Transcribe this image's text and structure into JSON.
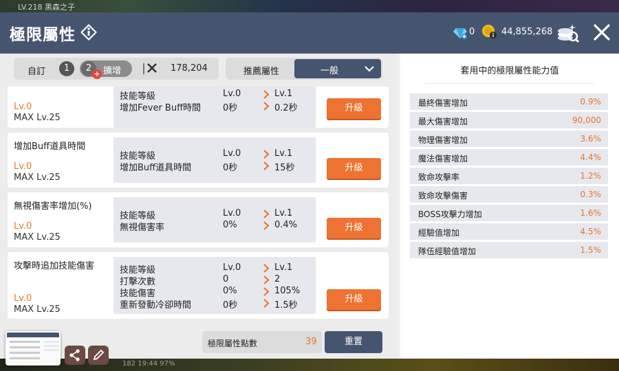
{
  "game_bg": {
    "level_text": "LV.218 黑森之子",
    "status_text": "182 19:44    97%"
  },
  "header": {
    "title": "極限屬性",
    "gem_count": "0",
    "gold_count": "44,855,268"
  },
  "filter": {
    "custom_tab": "自訂",
    "slot1": "1",
    "slot2": "2",
    "expand_label": "擴增",
    "points": "178,204",
    "recommend_label": "推薦屬性",
    "recommend_value": "一般"
  },
  "cards": [
    {
      "name": "",
      "level": "Lv.0",
      "max": "MAX Lv.25",
      "upgrade": "升級",
      "stats": [
        {
          "name": "技能等級",
          "cur": "Lv.0",
          "next": "Lv.1"
        },
        {
          "name": "增加Fever Buff時間",
          "cur": "0秒",
          "next": "0.2秒"
        }
      ]
    },
    {
      "name": "增加Buff道具時間",
      "level": "Lv.0",
      "max": "MAX Lv.25",
      "upgrade": "升級",
      "stats": [
        {
          "name": "技能等級",
          "cur": "Lv.0",
          "next": "Lv.1"
        },
        {
          "name": "增加Buff道具時間",
          "cur": "0秒",
          "next": "15秒"
        }
      ]
    },
    {
      "name": "無視傷害率增加(%)",
      "level": "Lv.0",
      "max": "MAX Lv.25",
      "upgrade": "升級",
      "stats": [
        {
          "name": "技能等級",
          "cur": "Lv.0",
          "next": "Lv.1"
        },
        {
          "name": "無視傷害率",
          "cur": "0%",
          "next": "0.4%"
        }
      ]
    },
    {
      "name": "攻擊時追加技能傷害",
      "level": "Lv.0",
      "max": "MAX Lv.25",
      "upgrade": "升級",
      "stats": [
        {
          "name": "技能等級",
          "cur": "Lv.0",
          "next": "Lv.1"
        },
        {
          "name": "打擊次數",
          "cur": "0",
          "next": "2"
        },
        {
          "name": "技能傷害",
          "cur": "0%",
          "next": "105%"
        },
        {
          "name": "重新發動冷卻時間",
          "cur": "0秒",
          "next": "1.5秒"
        }
      ]
    }
  ],
  "bottom": {
    "points_label": "極限屬性點數",
    "points_value": "39",
    "reset_label": "重置"
  },
  "summary": {
    "title": "套用中的極限屬性能力值",
    "rows": [
      {
        "name": "最終傷害增加",
        "value": "0.9%"
      },
      {
        "name": "最大傷害增加",
        "value": "90,000"
      },
      {
        "name": "物理傷害增加",
        "value": "3.6%"
      },
      {
        "name": "魔法傷害增加",
        "value": "4.4%"
      },
      {
        "name": "致命攻擊率",
        "value": "1.2%"
      },
      {
        "name": "致命攻擊傷害",
        "value": "0.3%"
      },
      {
        "name": "BOSS攻擊力增加",
        "value": "1.6%"
      },
      {
        "name": "經驗值增加",
        "value": "4.5%"
      },
      {
        "name": "隊伍經驗值增加",
        "value": "1.5%"
      }
    ]
  },
  "colors": {
    "header": "#46556f",
    "accent": "#ee7332",
    "value_orange": "#e8742f"
  }
}
